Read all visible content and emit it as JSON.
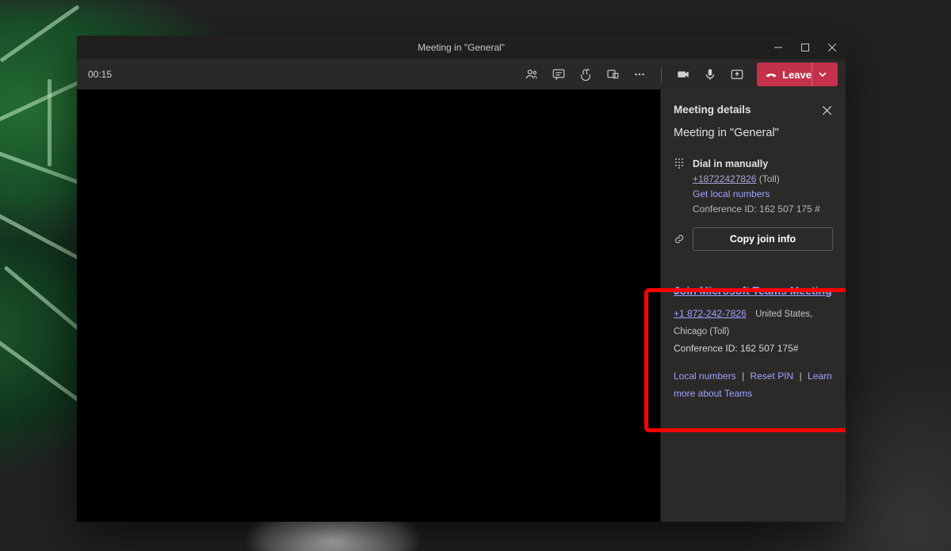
{
  "window": {
    "title": "Meeting in \"General\""
  },
  "toolbar": {
    "timer": "00:15",
    "leave_label": "Leave"
  },
  "panel": {
    "heading": "Meeting details",
    "meeting_title": "Meeting in \"General\"",
    "dial": {
      "label": "Dial in manually",
      "phone": "+18722427826",
      "toll_suffix": " (Toll)",
      "get_local_numbers": "Get local numbers",
      "conf_id_label": "Conference ID: ",
      "conf_id_value": "162 507 175 #"
    },
    "copy_button": "Copy join info",
    "join": {
      "headline": "Join Microsoft Teams Meeting",
      "phone": "+1 872-242-7826",
      "location": "United States, Chicago (Toll)",
      "conf_id_label": "Conference ID: ",
      "conf_id_value": "162 507 175#",
      "links": {
        "local_numbers": "Local numbers",
        "reset_pin": "Reset PIN",
        "learn_more": "Learn more about Teams"
      }
    }
  }
}
